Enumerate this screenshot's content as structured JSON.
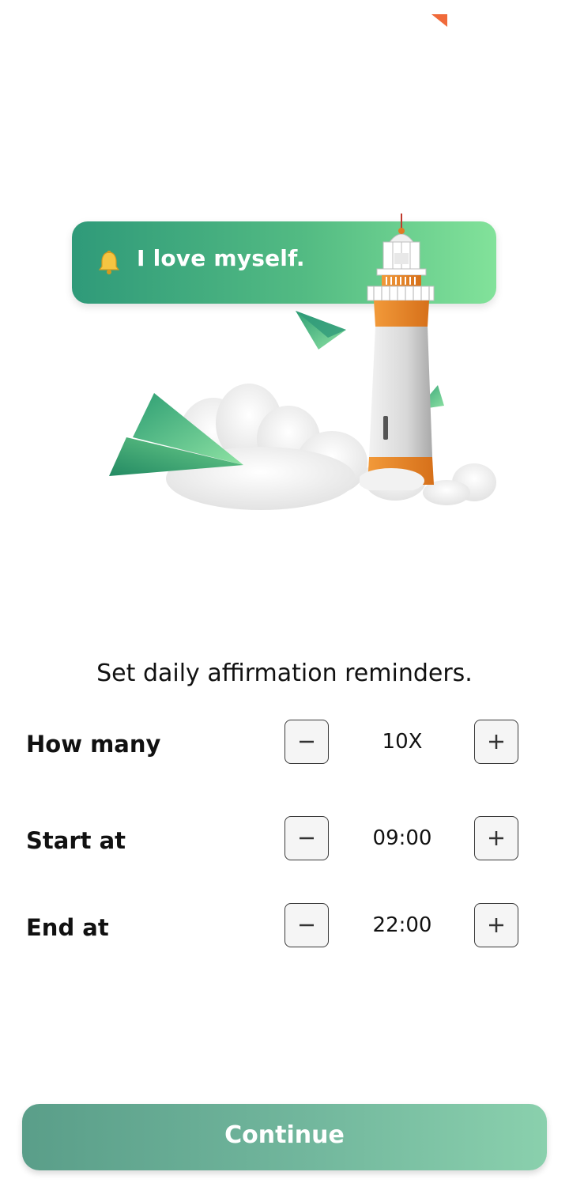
{
  "banner": {
    "text": "I love myself.",
    "icon": "bell-icon"
  },
  "headline": "Set daily affirmation reminders.",
  "settings": [
    {
      "label": "How many",
      "value": "10X"
    },
    {
      "label": "Start at",
      "value": "09:00"
    },
    {
      "label": "End at",
      "value": "22:00"
    }
  ],
  "continue_label": "Continue",
  "colors": {
    "accent_green": "#2f9a79",
    "accent_light_green": "#82e29a",
    "lighthouse_orange": "#e8862a",
    "button_green": "#6aae95",
    "corner_mark": "#f06a3a"
  }
}
